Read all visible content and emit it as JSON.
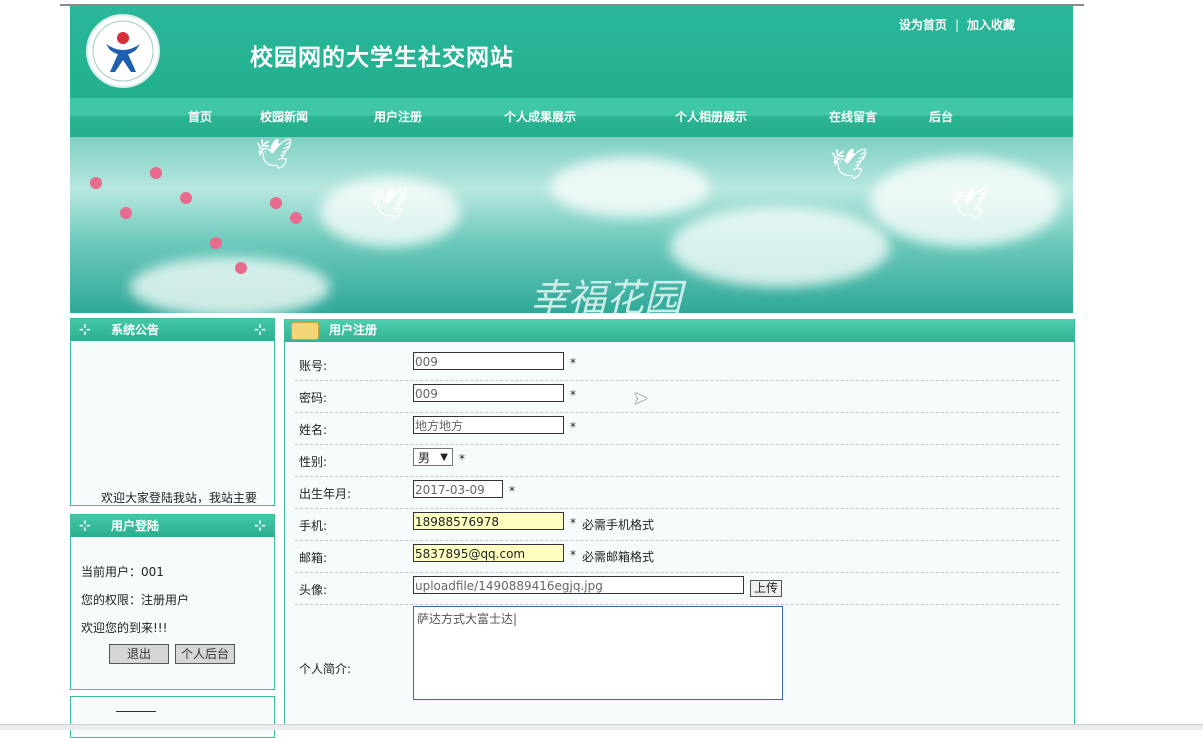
{
  "site": {
    "title": "校园网的大学生社交网站",
    "toplinks": [
      "设为首页",
      "加入收藏"
    ],
    "nav": [
      "首页",
      "校园新闻",
      "用户注册",
      "个人成果展示",
      "个人相册展示",
      "在线留言",
      "后台"
    ],
    "banner_text": "幸福花园",
    "accent": "#2ab79a"
  },
  "sidebar": {
    "notice_title": "系统公告",
    "notice_marquee": "欢迎大家登陆我站，我站主要",
    "login_title": "用户登陆",
    "current_user_label": "当前用户：001",
    "role_label": "您的权限：注册用户",
    "welcome": "欢迎您的到来!!!",
    "logout_btn": "退出",
    "backend_btn": "个人后台"
  },
  "form": {
    "title": "用户注册",
    "fields": {
      "account": {
        "label": "账号:",
        "value": "009"
      },
      "password": {
        "label": "密码:",
        "value": "009"
      },
      "name": {
        "label": "姓名:",
        "value": "地方地方"
      },
      "gender": {
        "label": "性别:",
        "value": "男"
      },
      "birth": {
        "label": "出生年月:",
        "value": "2017-03-09"
      },
      "phone": {
        "label": "手机:",
        "value": "18988576978",
        "hint": "必需手机格式"
      },
      "email": {
        "label": "邮箱:",
        "value": "5837895@qq.com",
        "hint": "必需邮箱格式"
      },
      "avatar": {
        "label": "头像:",
        "value": "uploadfile/1490889416egjq.jpg",
        "button": "上传"
      },
      "bio": {
        "label": "个人简介:",
        "value": "萨达方式大富士达|"
      }
    },
    "required_mark": "*"
  }
}
